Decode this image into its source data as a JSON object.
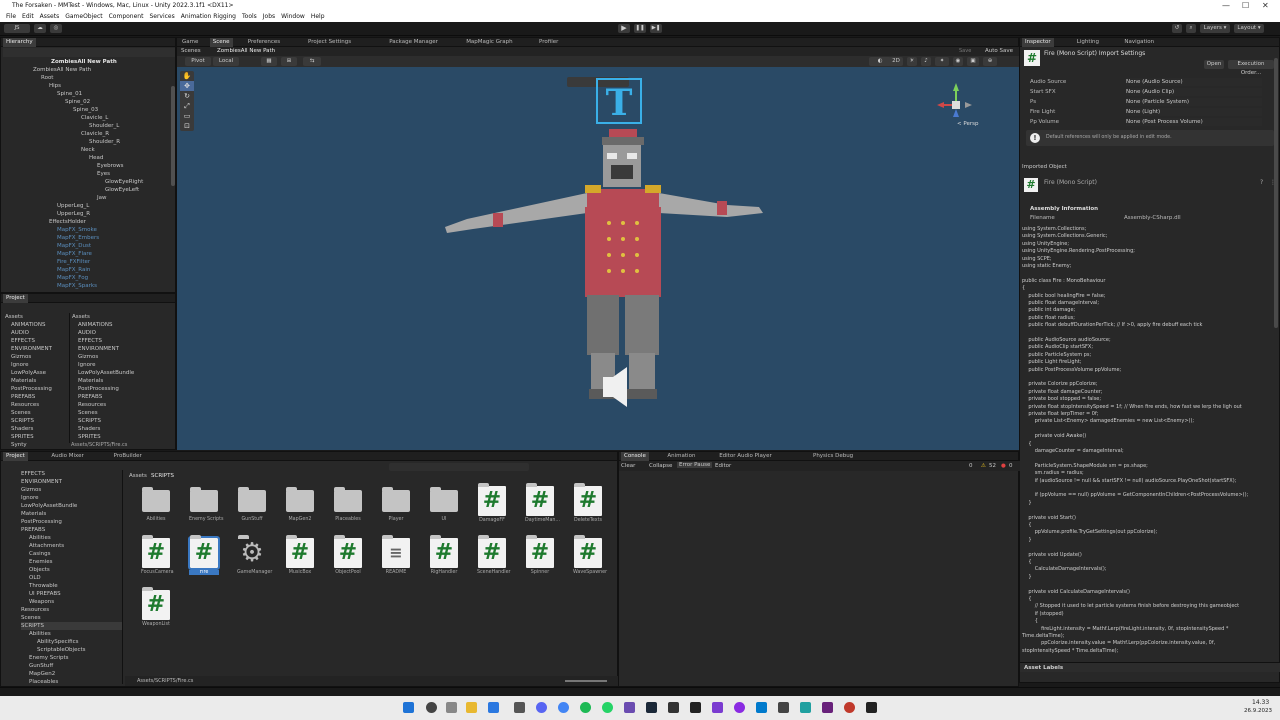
{
  "window": {
    "title": "The Forsaken - MMTest - Windows, Mac, Linux - Unity 2022.3.1f1 <DX11>",
    "controls": [
      "—",
      "☐",
      "✕"
    ]
  },
  "menu": [
    "File",
    "Edit",
    "Assets",
    "GameObject",
    "Component",
    "Services",
    "Animation Rigging",
    "Tools",
    "Jobs",
    "Window",
    "Help"
  ],
  "toolbar": {
    "account": "JS",
    "layers": "Layers",
    "layout": "Layout"
  },
  "hierarchy": {
    "tab": "Hierarchy",
    "scene": "ZombiesAll New Path",
    "items": [
      {
        "label": "ZombiesAll New Path",
        "indent": 0,
        "faded": false
      },
      {
        "label": "Root",
        "indent": 1,
        "faded": false
      },
      {
        "label": "Hips",
        "indent": 2,
        "faded": false
      },
      {
        "label": "Spine_01",
        "indent": 3,
        "faded": false
      },
      {
        "label": "Spine_02",
        "indent": 4,
        "faded": false
      },
      {
        "label": "Spine_03",
        "indent": 5,
        "faded": false
      },
      {
        "label": "Clavicle_L",
        "indent": 6,
        "faded": false
      },
      {
        "label": "Shoulder_L",
        "indent": 7,
        "faded": false
      },
      {
        "label": "Clavicle_R",
        "indent": 6,
        "faded": false
      },
      {
        "label": "Shoulder_R",
        "indent": 7,
        "faded": false
      },
      {
        "label": "Neck",
        "indent": 6,
        "faded": false
      },
      {
        "label": "Head",
        "indent": 7,
        "faded": false
      },
      {
        "label": "Eyebrows",
        "indent": 8,
        "faded": false
      },
      {
        "label": "Eyes",
        "indent": 8,
        "faded": false
      },
      {
        "label": "GlowEyeRight",
        "indent": 9,
        "faded": false
      },
      {
        "label": "GlowEyeLeft",
        "indent": 9,
        "faded": false
      },
      {
        "label": "Jaw",
        "indent": 8,
        "faded": false
      },
      {
        "label": "UpperLeg_L",
        "indent": 3,
        "faded": false
      },
      {
        "label": "UpperLeg_R",
        "indent": 3,
        "faded": false
      },
      {
        "label": "EffectsHolder",
        "indent": 2,
        "faded": false
      },
      {
        "label": "MapFX_Smoke",
        "indent": 3,
        "faded": true
      },
      {
        "label": "MapFX_Embers",
        "indent": 3,
        "faded": true
      },
      {
        "label": "MapFX_Dust",
        "indent": 3,
        "faded": true
      },
      {
        "label": "MapFX_Flare",
        "indent": 3,
        "faded": true
      },
      {
        "label": "Fire_FXFilter",
        "indent": 3,
        "faded": true
      },
      {
        "label": "MapFX_Rain",
        "indent": 3,
        "faded": true
      },
      {
        "label": "MapFX_Fog",
        "indent": 3,
        "faded": true
      },
      {
        "label": "MapFX_Sparks",
        "indent": 3,
        "faded": true
      }
    ]
  },
  "topProject": {
    "tab": "Project",
    "left": [
      "Assets",
      "ANIMATIONS",
      "AUDIO",
      "EFFECTS",
      "ENVIRONMENT",
      "Gizmos",
      "Ignore",
      "LowPolyAsse",
      "Materials",
      "PostProcessing",
      "PREFABS",
      "Resources",
      "Scenes",
      "SCRIPTS",
      "Shaders",
      "SPRITES",
      "Synty"
    ],
    "right": [
      "Assets",
      "ANIMATIONS",
      "AUDIO",
      "EFFECTS",
      "ENVIRONMENT",
      "Gizmos",
      "Ignore",
      "LowPolyAssetBundle",
      "Materials",
      "PostProcessing",
      "PREFABS",
      "Resources",
      "Scenes",
      "SCRIPTS",
      "Shaders",
      "SPRITES"
    ],
    "path": "Assets/SCRIPTS/Fire.cs"
  },
  "sceneTabs": [
    "Game",
    "Scene",
    "Preferences",
    "Project Settings",
    "Package Manager",
    "MapMagic Graph",
    "Profiler"
  ],
  "sceneBreadcrumb": [
    "Scenes",
    "ZombiesAll New Path"
  ],
  "sceneTools": {
    "pivot": "Pivot",
    "local": "Local",
    "mode": "2D",
    "save": "Save",
    "autosave": "Auto Save",
    "persp": "< Persp"
  },
  "bottomTabs": [
    "Project",
    "Audio Mixer",
    "ProBuilder"
  ],
  "bottomTree": [
    "EFFECTS",
    "ENVIRONMENT",
    "Gizmos",
    "Ignore",
    "LowPolyAssetBundle",
    "Materials",
    "PostProcessing",
    "PREFABS",
    "Abilities",
    "Attachments",
    "Casings",
    "Enemies",
    "Objects",
    "OLD",
    "Throwable",
    "UI PREFABS",
    "Weapons",
    "Resources",
    "Scenes",
    "SCRIPTS",
    "Abilities",
    "AbilitySpecifics",
    "ScriptableObjects",
    "Enemy Scripts",
    "GunStuff",
    "MapGen2",
    "Placeables"
  ],
  "breadcrumbAssets": "Assets",
  "breadcrumbScripts": "SCRIPTS",
  "assets": [
    {
      "name": "Abilities",
      "kind": "folder"
    },
    {
      "name": "Enemy Scripts",
      "kind": "folder"
    },
    {
      "name": "GunStuff",
      "kind": "folder"
    },
    {
      "name": "MapGen2",
      "kind": "folder"
    },
    {
      "name": "Placeables",
      "kind": "folder"
    },
    {
      "name": "Player",
      "kind": "folder"
    },
    {
      "name": "UI",
      "kind": "folder"
    },
    {
      "name": "DamageFF",
      "kind": "script"
    },
    {
      "name": "DaytimeMan...",
      "kind": "script"
    },
    {
      "name": "DeleteTexts",
      "kind": "script"
    },
    {
      "name": "FocusCamera",
      "kind": "script"
    },
    {
      "name": "Fire",
      "kind": "script"
    },
    {
      "name": "GameManager",
      "kind": "gear"
    },
    {
      "name": "MusicBox",
      "kind": "script"
    },
    {
      "name": "ObjectPool",
      "kind": "script"
    },
    {
      "name": "README",
      "kind": "text"
    },
    {
      "name": "RigHandler",
      "kind": "script"
    },
    {
      "name": "SceneHandler",
      "kind": "script"
    },
    {
      "name": "Spinner",
      "kind": "script"
    },
    {
      "name": "WaveSpawner",
      "kind": "script"
    },
    {
      "name": "WeaponList",
      "kind": "script"
    }
  ],
  "assetsPath": "Assets/SCRIPTS/Fire.cs",
  "consoleTabs": [
    "Console",
    "Animation",
    "Editor Audio Player",
    "Physics Debug"
  ],
  "console": {
    "clear": "Clear",
    "collapse": "Collapse",
    "errorPause": "Error Pause",
    "editor": "Editor",
    "count0": "0",
    "count52": "52",
    "count0b": "0"
  },
  "inspectorTabs": [
    "Inspector",
    "Lighting",
    "Navigation"
  ],
  "inspector": {
    "title": "Fire (Mono Script) Import Settings",
    "open": "Open",
    "execOrder": "Execution Order...",
    "fields": [
      {
        "label": "Audio Source",
        "value": "None (Audio Source)"
      },
      {
        "label": "Start SFX",
        "value": "None (Audio Clip)"
      },
      {
        "label": "Ps",
        "value": "None (Particle System)"
      },
      {
        "label": "Fire Light",
        "value": "None (Light)"
      },
      {
        "label": "Pp Volume",
        "value": "None (Post Process Volume)"
      }
    ],
    "note": "Default references will only be applied in edit mode.",
    "imported": "Imported Object",
    "objName": "Fire (Mono Script)",
    "assembly": "Assembly Information",
    "filenameLabel": "Filename",
    "filename": "Assembly-CSharp.dll",
    "assetLabels": "Asset Labels"
  },
  "code": [
    "using System.Collections;",
    "using System.Collections.Generic;",
    "using UnityEngine;",
    "using UnityEngine.Rendering.PostProcessing;",
    "using SCPE;",
    "using static Enemy;",
    "",
    "public class Fire : MonoBehaviour",
    "{",
    "    public bool healingFire = false;",
    "    public float damageInterval;",
    "    public int damage;",
    "    public float radius;",
    "    public float debuffDurationPerTick; // If >0, apply fire debuff each tick",
    "",
    "    public AudioSource audioSource;",
    "    public AudioClip startSFX;",
    "    public ParticleSystem ps;",
    "    public Light fireLight;",
    "    public PostProcessVolume ppVolume;",
    "",
    "    private Colorize ppColorize;",
    "    private float damageCounter;",
    "    private bool stopped = false;",
    "    private float stopIntensitySpeed = 1f; // When fire ends, how fast we lerp the ligh out",
    "    private float lerpTimer = 0f;",
    "        private List<Enemy> damagedEnemies = new List<Enemy>();",
    "",
    "        private void Awake()",
    "    {",
    "        damageCounter = damageInterval;",
    "",
    "        ParticleSystem.ShapeModule sm = ps.shape;",
    "        sm.radius = radius;",
    "        if (audioSource != null && startSFX != null) audioSource.PlayOneShot(startSFX);",
    "",
    "        if (ppVolume == null) ppVolume = GetComponentInChildren<PostProcessVolume>();",
    "    }",
    "",
    "    private void Start()",
    "    {",
    "        ppVolume.profile.TryGetSettings(out ppColorize);",
    "    }",
    "",
    "    private void Update()",
    "    {",
    "        CalculateDamageIntervals();",
    "    }",
    "",
    "    private void CalculateDamageIntervals()",
    "    {",
    "        // Stopped it used to let particle systems finish before destroying this gameobject",
    "        if (stopped)",
    "        {",
    "            fireLight.intensity = Mathf.Lerp(fireLight.intensity, 0f, stopIntensitySpeed *",
    "Time.deltaTime);",
    "            ppColorize.intensity.value = Mathf.Lerp(ppColorize.intensity.value, 0f,",
    "stopIntensitySpeed * Time.deltaTime);"
  ],
  "taskbar": {
    "time": "14.33",
    "date": "26.9.2023"
  },
  "colors": {
    "sceneBg": "#2a4a66",
    "coat": "#b74a55",
    "accent": "#3a78c2"
  }
}
